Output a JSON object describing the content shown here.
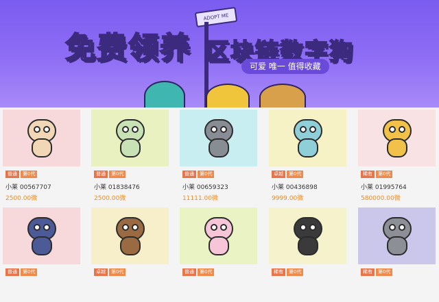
{
  "banner": {
    "headline_left": "免费领养",
    "headline_right": "区块链数字狗",
    "subtitle": "可爱 唯一 值得收藏",
    "sign_text": "ADOPT ME",
    "bg_color": "#7a5cf0"
  },
  "cards": [
    {
      "rarity": "普通",
      "generation": "第0代",
      "name": "小莱 00567707",
      "price": "2500.00微",
      "bg": "#f7d9dc",
      "dog_color": "#f1d7b5"
    },
    {
      "rarity": "普通",
      "generation": "第0代",
      "name": "小莱 01838476",
      "price": "2500.00微",
      "bg": "#e8f1bf",
      "dog_color": "#c8e2b6"
    },
    {
      "rarity": "普通",
      "generation": "第0代",
      "name": "小莱 00659323",
      "price": "11111.00微",
      "bg": "#c9eef2",
      "dog_color": "#888c94"
    },
    {
      "rarity": "卓越",
      "generation": "第0代",
      "name": "小莱 00436898",
      "price": "9999.00微",
      "bg": "#f7f1c6",
      "dog_color": "#8fd0d8"
    },
    {
      "rarity": "稀有",
      "generation": "第0代",
      "name": "小莱 01995764",
      "price": "580000.00微",
      "bg": "#f8e2e3",
      "dog_color": "#f2c14a"
    },
    {
      "rarity": "普通",
      "generation": "第0代",
      "name": "",
      "price": "",
      "bg": "#f7d9dc",
      "dog_color": "#4c5a98"
    },
    {
      "rarity": "卓越",
      "generation": "第0代",
      "name": "",
      "price": "",
      "bg": "#f7efc9",
      "dog_color": "#9a6a42"
    },
    {
      "rarity": "普通",
      "generation": "第0代",
      "name": "",
      "price": "",
      "bg": "#e9f3c3",
      "dog_color": "#f6c6d8"
    },
    {
      "rarity": "稀有",
      "generation": "第0代",
      "name": "",
      "price": "",
      "bg": "#f6f2cc",
      "dog_color": "#3a3a3a"
    },
    {
      "rarity": "稀有",
      "generation": "第0代",
      "name": "",
      "price": "",
      "bg": "#cbc7ea",
      "dog_color": "#8c8f96"
    }
  ]
}
